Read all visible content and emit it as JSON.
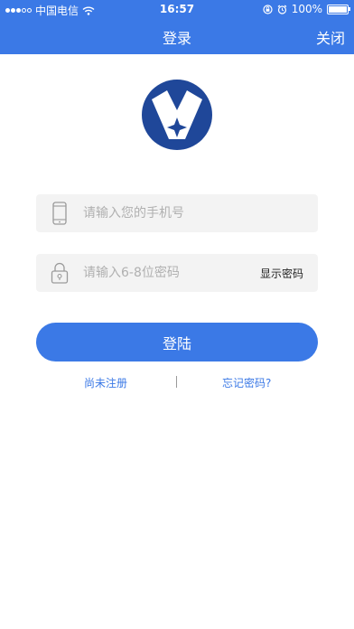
{
  "status_bar": {
    "carrier": "中国电信",
    "time": "16:57",
    "battery": "100%",
    "signal_icon": "signal-icon",
    "wifi_icon": "wifi-icon",
    "lock_icon": "orientation-lock-icon",
    "alarm_icon": "alarm-icon"
  },
  "header": {
    "title": "登录",
    "close_label": "关闭",
    "background": "#3b79e6"
  },
  "logo": {
    "icon": "app-logo",
    "color": "#1f4799"
  },
  "form": {
    "phone": {
      "placeholder": "请输入您的手机号",
      "value": "",
      "icon": "phone-icon"
    },
    "password": {
      "placeholder": "请输入6-8位密码",
      "value": "",
      "icon": "lock-icon",
      "toggle_label": "显示密码"
    },
    "login_label": "登陆"
  },
  "links": {
    "register": "尚未注册",
    "forgot": "忘记密码?"
  },
  "colors": {
    "accent": "#3b79e6",
    "field_bg": "#f3f3f3",
    "placeholder": "#b0b0b0"
  }
}
